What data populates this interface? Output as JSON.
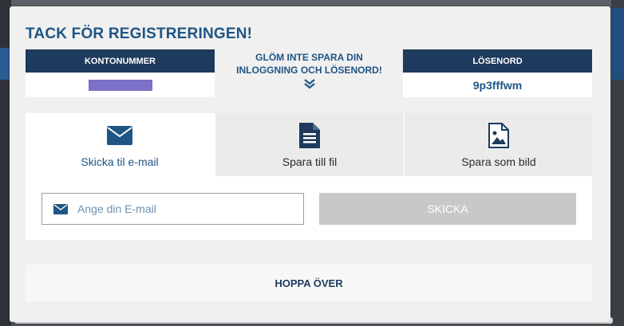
{
  "modal": {
    "title": "TACK FÖR REGISTRERINGEN!",
    "account": {
      "header": "KONTONUMMER"
    },
    "reminder": {
      "line1": "GLÖM INTE SPARA DIN",
      "line2": "INLOGGNING OCH LÖSENORD!"
    },
    "password": {
      "header": "LÖSENORD",
      "value": "9p3fffwm"
    },
    "tabs": [
      {
        "label": "Skicka til e-mail",
        "icon": "envelope-icon",
        "active": true
      },
      {
        "label": "Spara till fil",
        "icon": "file-icon",
        "active": false
      },
      {
        "label": "Spara som bild",
        "icon": "image-file-icon",
        "active": false
      }
    ],
    "email": {
      "placeholder": "Ange din E-mail",
      "value": ""
    },
    "send_label": "SKICKA",
    "skip_label": "HOPPA ÖVER"
  },
  "colors": {
    "accent": "#1f5585",
    "header_bg": "#1e3a5c",
    "redacted": "#7b71c7",
    "disabled_button": "#c8c8c8"
  }
}
